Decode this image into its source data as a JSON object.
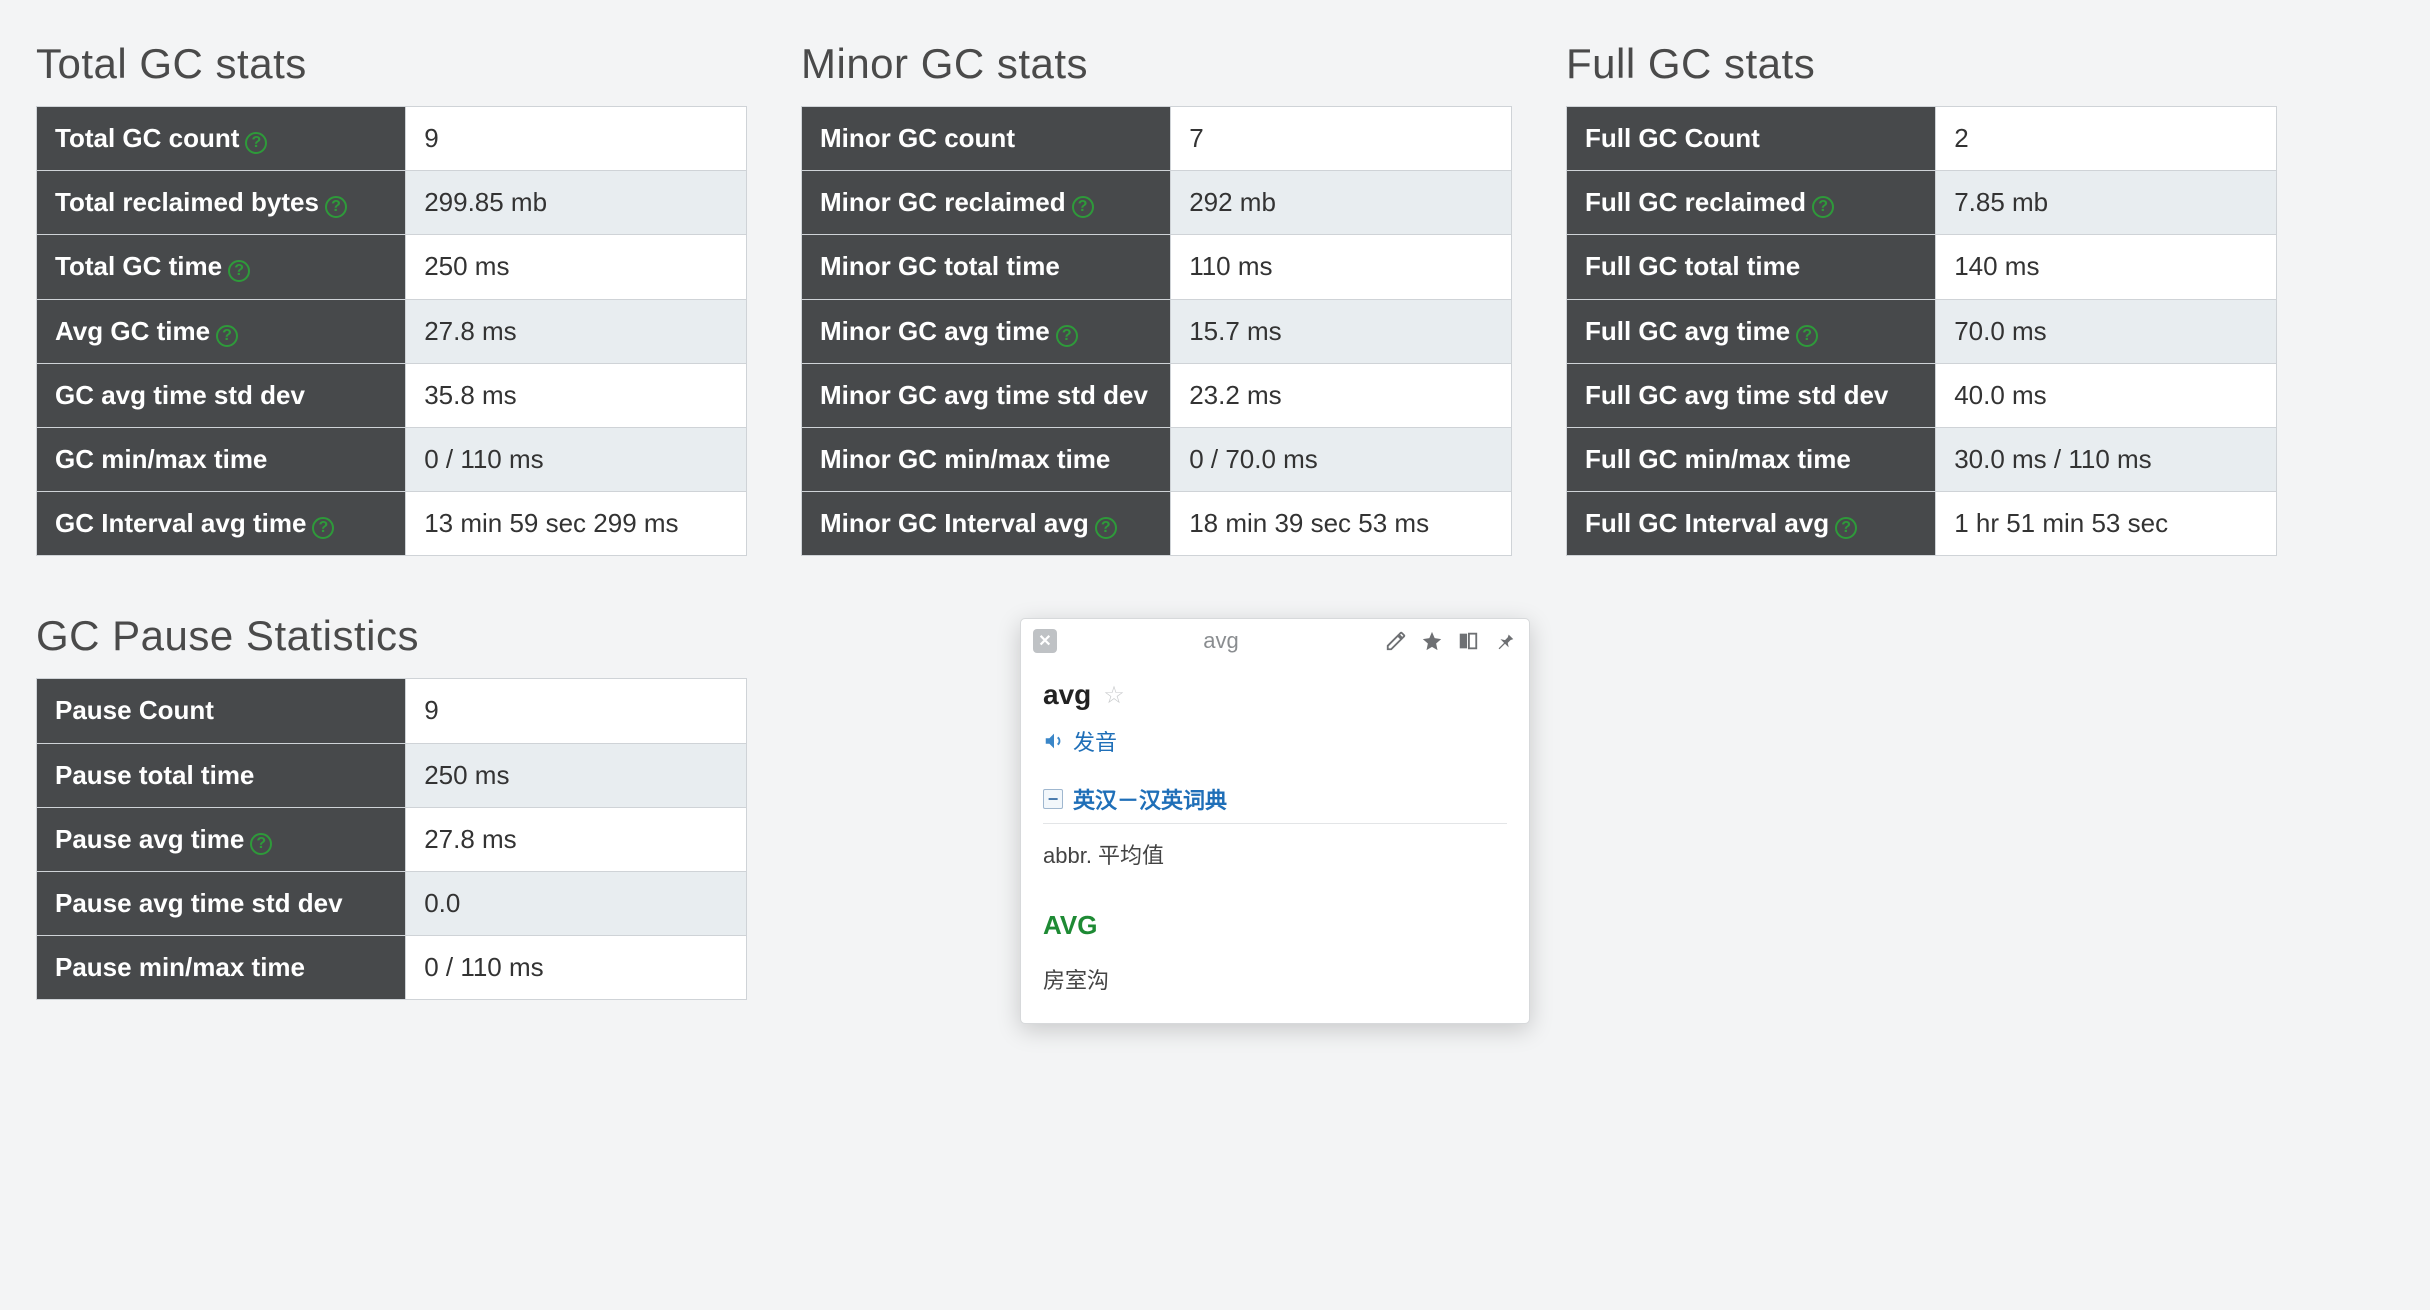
{
  "sections": {
    "total": {
      "title": "Total GC stats",
      "rows": [
        {
          "label": "Total GC count",
          "help": true,
          "value": "9"
        },
        {
          "label": "Total reclaimed bytes",
          "help": true,
          "value": "299.85 mb"
        },
        {
          "label": "Total GC time",
          "help": true,
          "value": "250 ms"
        },
        {
          "label": "Avg GC time",
          "help": true,
          "value": "27.8 ms"
        },
        {
          "label": "GC avg time std dev",
          "help": false,
          "value": "35.8 ms"
        },
        {
          "label": "GC min/max time",
          "help": false,
          "value": "0 / 110 ms"
        },
        {
          "label": "GC Interval avg time",
          "help": true,
          "value": "13 min 59 sec 299 ms"
        }
      ]
    },
    "minor": {
      "title": "Minor GC stats",
      "rows": [
        {
          "label": "Minor GC count",
          "help": false,
          "value": "7"
        },
        {
          "label": "Minor GC reclaimed",
          "help": true,
          "value": "292 mb"
        },
        {
          "label": "Minor GC total time",
          "help": false,
          "value": "110 ms"
        },
        {
          "label": "Minor GC avg time",
          "help": true,
          "value": "15.7 ms"
        },
        {
          "label": "Minor GC avg time std dev",
          "help": false,
          "value": "23.2 ms"
        },
        {
          "label": "Minor GC min/max time",
          "help": false,
          "value": "0 / 70.0 ms"
        },
        {
          "label": "Minor GC Interval avg",
          "help": true,
          "value": "18 min 39 sec 53 ms"
        }
      ]
    },
    "full": {
      "title": "Full GC stats",
      "rows": [
        {
          "label": "Full GC Count",
          "help": false,
          "value": "2"
        },
        {
          "label": "Full GC reclaimed",
          "help": true,
          "value": "7.85 mb"
        },
        {
          "label": "Full GC total time",
          "help": false,
          "value": "140 ms"
        },
        {
          "label": "Full GC avg time",
          "help": true,
          "value": "70.0 ms"
        },
        {
          "label": "Full GC avg time std dev",
          "help": false,
          "value": "40.0 ms"
        },
        {
          "label": "Full GC min/max time",
          "help": false,
          "value": "30.0 ms / 110 ms"
        },
        {
          "label": "Full GC Interval avg",
          "help": true,
          "value": "1 hr 51 min 53 sec"
        }
      ]
    },
    "pause": {
      "title": "GC Pause Statistics",
      "rows": [
        {
          "label": "Pause Count",
          "help": false,
          "value": "9"
        },
        {
          "label": "Pause total time",
          "help": false,
          "value": "250 ms"
        },
        {
          "label": "Pause avg time",
          "help": true,
          "value": "27.8 ms"
        },
        {
          "label": "Pause avg time std dev",
          "help": false,
          "value": "0.0"
        },
        {
          "label": "Pause min/max time",
          "help": false,
          "value": "0 / 110 ms"
        }
      ]
    }
  },
  "dict": {
    "search_value": "avg",
    "word": "avg",
    "pron_label": "发音",
    "section_label": "英汉－汉英词典",
    "def1": "abbr. 平均值",
    "word_upper": "AVG",
    "def2": "房室沟"
  }
}
